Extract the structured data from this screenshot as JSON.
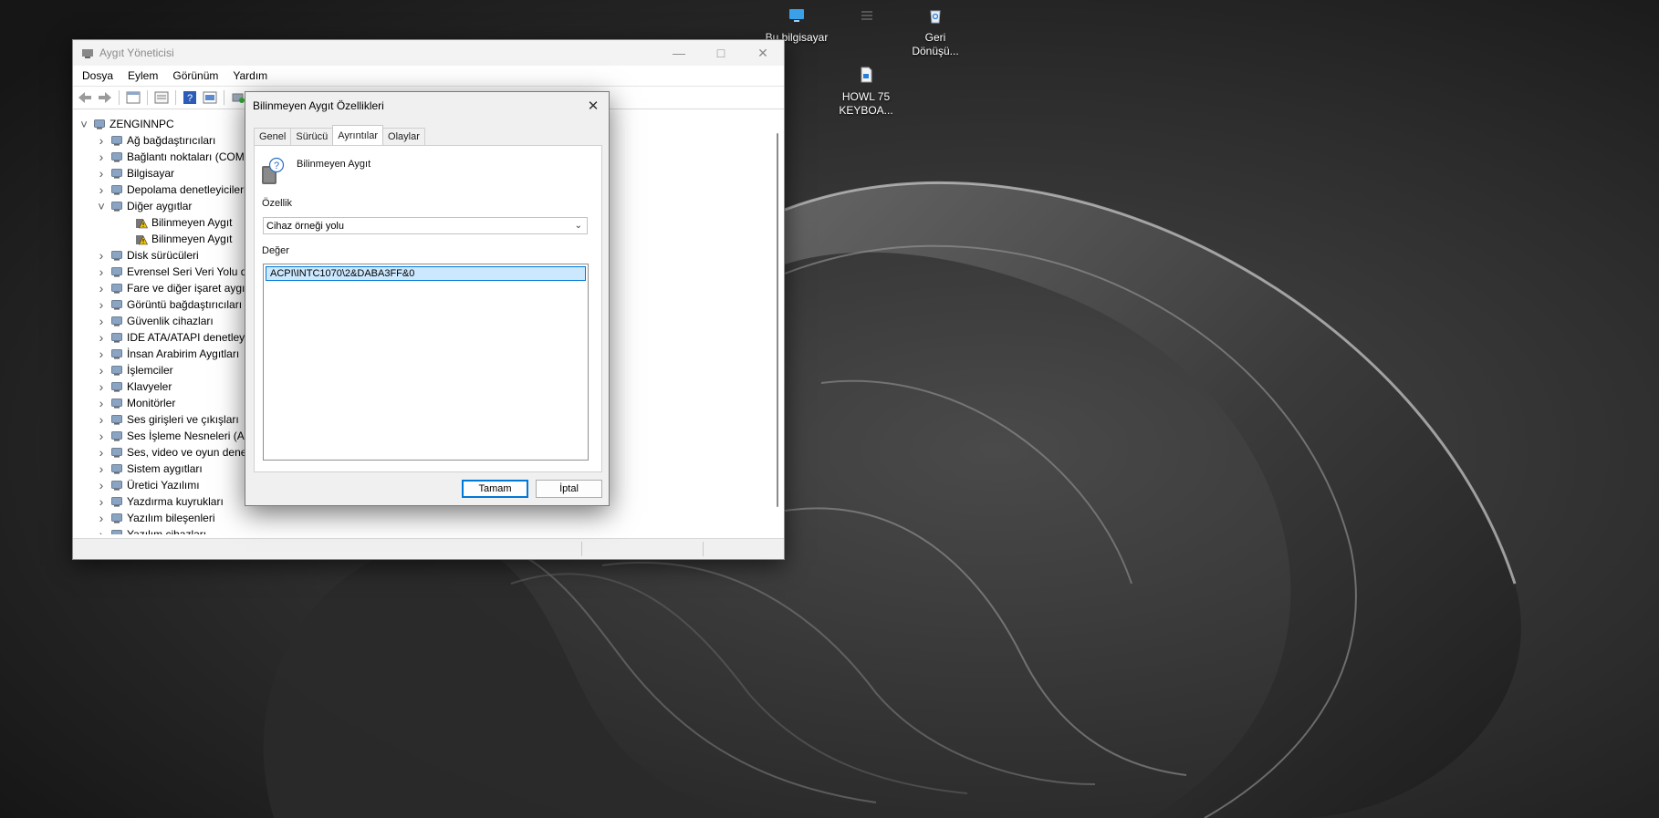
{
  "desktop": {
    "icons": [
      {
        "label": "Bu bilgisayar",
        "icon": "monitor-icon"
      },
      {
        "label": "",
        "icon": "desktop-shortcut-icon"
      },
      {
        "label": "Geri Dönüşü...",
        "icon": "recycle-bin-icon"
      },
      {
        "label": "HOWL 75 KEYBOA...",
        "icon": "document-icon"
      }
    ]
  },
  "device_manager": {
    "title": "Aygıt Yöneticisi",
    "menu": [
      "Dosya",
      "Eylem",
      "Görünüm",
      "Yardım"
    ],
    "toolbar_icons": [
      "back-icon",
      "forward-icon",
      "properties-icon",
      "scan-icon",
      "help-icon",
      "view-icon",
      "update-driver-icon"
    ],
    "root": "ZENGINNPC",
    "tree": [
      {
        "label": "Ağ bağdaştırıcıları",
        "icon": "network-icon",
        "expanded": false
      },
      {
        "label": "Bağlantı noktaları (COM",
        "icon": "port-icon",
        "expanded": false
      },
      {
        "label": "Bilgisayar",
        "icon": "computer-icon",
        "expanded": false
      },
      {
        "label": "Depolama denetleyicileri",
        "icon": "storage-icon",
        "expanded": false
      },
      {
        "label": "Diğer aygıtlar",
        "icon": "unknown-device-icon",
        "expanded": true,
        "children": [
          "Bilinmeyen Aygıt",
          "Bilinmeyen Aygıt"
        ]
      },
      {
        "label": "Disk sürücüleri",
        "icon": "disk-icon",
        "expanded": false
      },
      {
        "label": "Evrensel Seri Veri Yolu de",
        "icon": "usb-icon",
        "expanded": false
      },
      {
        "label": "Fare ve diğer işaret aygıt",
        "icon": "mouse-icon",
        "expanded": false
      },
      {
        "label": "Görüntü bağdaştırıcıları",
        "icon": "display-adapter-icon",
        "expanded": false
      },
      {
        "label": "Güvenlik cihazları",
        "icon": "security-icon",
        "expanded": false
      },
      {
        "label": "IDE ATA/ATAPI denetley",
        "icon": "ide-icon",
        "expanded": false
      },
      {
        "label": "İnsan Arabirim Aygıtları",
        "icon": "hid-icon",
        "expanded": false
      },
      {
        "label": "İşlemciler",
        "icon": "processor-icon",
        "expanded": false
      },
      {
        "label": "Klavyeler",
        "icon": "keyboard-icon",
        "expanded": false
      },
      {
        "label": "Monitörler",
        "icon": "monitor-icon",
        "expanded": false
      },
      {
        "label": "Ses girişleri ve çıkışları",
        "icon": "speaker-icon",
        "expanded": false
      },
      {
        "label": "Ses İşleme Nesneleri (AP",
        "icon": "speaker-icon",
        "expanded": false
      },
      {
        "label": "Ses, video ve oyun dene",
        "icon": "speaker-icon",
        "expanded": false
      },
      {
        "label": "Sistem aygıtları",
        "icon": "system-icon",
        "expanded": false
      },
      {
        "label": "Üretici Yazılımı",
        "icon": "firmware-icon",
        "expanded": false
      },
      {
        "label": "Yazdırma kuyrukları",
        "icon": "printer-icon",
        "expanded": false
      },
      {
        "label": "Yazılım bileşenleri",
        "icon": "software-component-icon",
        "expanded": false
      },
      {
        "label": "Yazılım cihazları",
        "icon": "software-device-icon",
        "expanded": false
      }
    ]
  },
  "dialog": {
    "title": "Bilinmeyen Aygıt Özellikleri",
    "tabs": [
      "Genel",
      "Sürücü",
      "Ayrıntılar",
      "Olaylar"
    ],
    "active_tab": "Ayrıntılar",
    "device_name": "Bilinmeyen Aygıt",
    "property_label": "Özellik",
    "property_value": "Cihaz örneği yolu",
    "value_label": "Değer",
    "value": "ACPI\\INTC1070\\2&DABA3FF&0",
    "ok_label": "Tamam",
    "cancel_label": "İptal"
  },
  "colors": {
    "accent": "#0078d7",
    "selection": "#cce8ff"
  }
}
